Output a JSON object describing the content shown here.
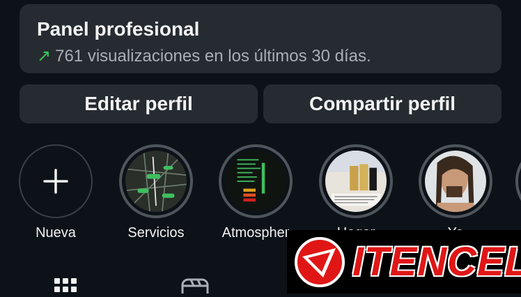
{
  "dashboard": {
    "title": "Panel profesional",
    "arrow_icon": "trend-up-icon",
    "stats_text": "761 visualizaciones en los últimos 30 días."
  },
  "actions": {
    "edit_label": "Editar perfil",
    "share_label": "Compartir perfil"
  },
  "highlights": [
    {
      "label": "Nueva",
      "icon": "plus-icon"
    },
    {
      "label": "Servicios"
    },
    {
      "label": "Atmospher"
    },
    {
      "label": "Hogar"
    },
    {
      "label": "Yo"
    }
  ],
  "tabs": [
    {
      "icon": "grid-icon"
    },
    {
      "icon": "reels-icon"
    },
    {
      "icon": "tagged-icon"
    }
  ],
  "watermark": {
    "text": "ITENCEL",
    "color": "#e01616"
  },
  "colors": {
    "background": "#0d1218",
    "card": "#262b31",
    "accent_green": "#35c759"
  }
}
